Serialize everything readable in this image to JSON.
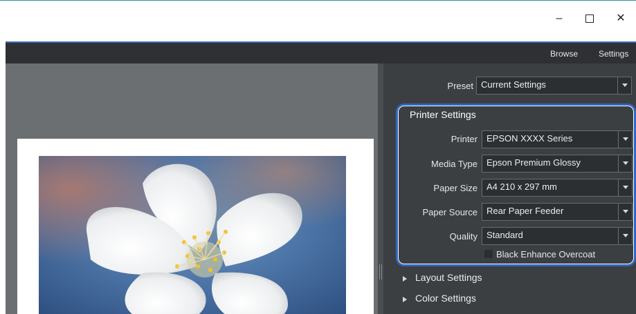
{
  "window": {
    "minimize_glyph": "–",
    "close_glyph": "✕"
  },
  "menubar": {
    "browse_label": "Browse",
    "settings_label": "Settings"
  },
  "preset": {
    "label": "Preset",
    "value": "Current Settings"
  },
  "printer_settings": {
    "title": "Printer Settings",
    "fields": [
      {
        "label": "Printer",
        "value": "EPSON XXXX Series"
      },
      {
        "label": "Media Type",
        "value": "Epson Premium Glossy"
      },
      {
        "label": "Paper Size",
        "value": "A4 210 x 297 mm"
      },
      {
        "label": "Paper Source",
        "value": "Rear Paper Feeder"
      },
      {
        "label": "Quality",
        "value": "Standard"
      }
    ],
    "checkbox_label": "Black Enhance Overcoat",
    "checkbox_checked": false,
    "highlight_color": "#2f66c4"
  },
  "sections": {
    "layout_settings": "Layout Settings",
    "color_settings": "Color Settings"
  },
  "icons": {
    "dropdown": "chevron-down-icon",
    "expand": "triangle-right-icon"
  }
}
